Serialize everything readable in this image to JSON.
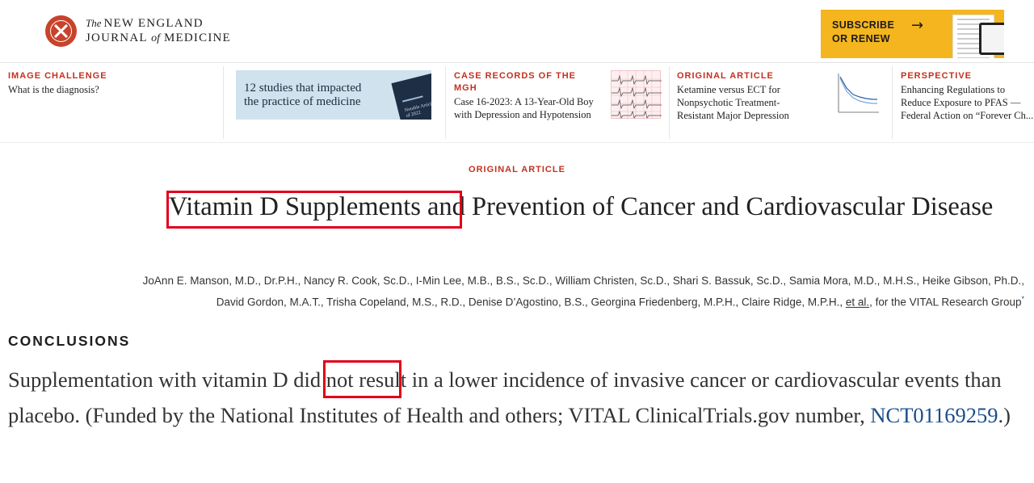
{
  "header": {
    "logo_the": "The",
    "logo_line1": "NEW ENGLAND",
    "logo_line2_a": "JOURNAL",
    "logo_line2_of": "of",
    "logo_line2_b": "MEDICINE",
    "subscribe_line1": "SUBSCRIBE",
    "subscribe_line2": "OR RENEW",
    "subscribe_icon": "arrow-right-icon"
  },
  "promos": [
    {
      "kicker": "IMAGE CHALLENGE",
      "title": "What is the diagnosis?"
    },
    {
      "kicker": "",
      "title_line1": "12 studies that impacted",
      "title_line2": "the practice of medicine",
      "book_text": "Notable Articles of 2022"
    },
    {
      "kicker": "CASE RECORDS OF THE MGH",
      "title": "Case 16-2023: A 13-Year-Old Boy with Depression and Hypotension"
    },
    {
      "kicker": "ORIGINAL ARTICLE",
      "title": "Ketamine versus ECT for Nonpsychotic Treatment-Resistant Major Depression"
    },
    {
      "kicker": "PERSPECTIVE",
      "title_line1": "Enhancing Regulations to",
      "title_line2": "Reduce Exposure to PFAS —",
      "title_line3": "Federal Action on “Forever Ch..."
    }
  ],
  "article": {
    "kicker": "ORIGINAL ARTICLE",
    "title": "Vitamin D Supplements and Prevention of Cancer and Cardiovascular Disease",
    "authors_main": "JoAnn E. Manson, M.D., Dr.P.H., Nancy R. Cook, Sc.D., I-Min Lee, M.B., B.S., Sc.D., William Christen, Sc.D., Shari S. Bassuk, Sc.D., Samia Mora, M.D., M.H.S., Heike Gibson, Ph.D., David Gordon, M.A.T., Trisha Copeland, M.S., R.D., Denise D’Agostino, B.S., Georgina Friedenberg, M.P.H., Claire Ridge, M.P.H.,",
    "authors_etal": "et al.",
    "authors_tail": ", for the VITAL Research Group",
    "authors_sup": "*",
    "section_heading": "CONCLUSIONS",
    "conclusion_text": "Supplementation with vitamin D did not result in a lower incidence of invasive cancer or cardiovascular events than placebo. (Funded by the National Institutes of Health and others; VITAL ClinicalTrials.gov number, ",
    "nct_link": "NCT01169259",
    "conclusion_end": ".)"
  },
  "colors": {
    "brand_red": "#c3311f",
    "subscribe_yellow": "#f5b51e",
    "link_blue": "#1a4d8c",
    "annotation_red": "#e2001a"
  }
}
